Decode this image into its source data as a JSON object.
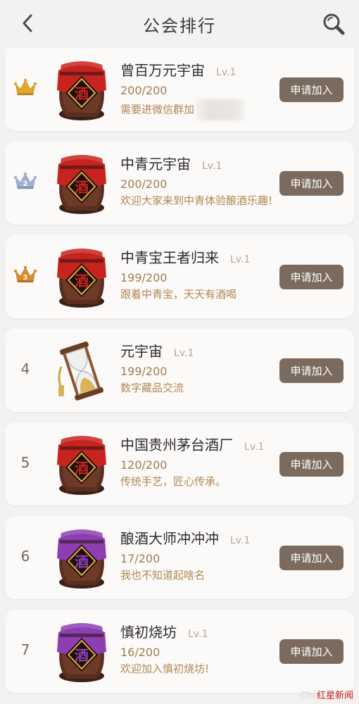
{
  "header": {
    "title": "公会排行"
  },
  "guilds": [
    {
      "rank": "",
      "rank_icon": "gold-crown-icon",
      "rank_color": "#e2a628",
      "emblem": "red-wine-jar-icon",
      "emblem_color": "#c7231f",
      "name": "曾百万元宇宙",
      "level": "Lv.1",
      "count": "200/200",
      "desc": "需要进微信群加",
      "join_label": "申请加入"
    },
    {
      "rank": "2",
      "rank_icon": "silver-crown-icon",
      "rank_color": "#9fb0d6",
      "emblem": "red-wine-jar-icon",
      "emblem_color": "#c7231f",
      "name": "中青元宇宙",
      "level": "Lv.1",
      "count": "200/200",
      "desc": "欢迎大家来到中青体验酿酒乐趣!",
      "join_label": "申请加入"
    },
    {
      "rank": "3",
      "rank_icon": "bronze-crown-icon",
      "rank_color": "#dd8a2b",
      "emblem": "red-wine-jar-icon",
      "emblem_color": "#c7231f",
      "name": "中青宝王者归来",
      "level": "Lv.1",
      "count": "199/200",
      "desc": "跟着中青宝，天天有酒喝",
      "join_label": "申请加入"
    },
    {
      "rank": "4",
      "emblem": "hourglass-icon",
      "name": "元宇宙",
      "level": "Lv.1",
      "count": "199/200",
      "desc": "数字藏品交流",
      "join_label": "申请加入"
    },
    {
      "rank": "5",
      "emblem": "red-wine-jar-icon",
      "emblem_color": "#c7231f",
      "name": "中国贵州茅台酒厂",
      "level": "Lv.1",
      "count": "120/200",
      "desc": "传统手艺，匠心传承。",
      "join_label": "申请加入"
    },
    {
      "rank": "6",
      "emblem": "purple-wine-jar-icon",
      "emblem_color": "#8d3fb1",
      "name": "酿酒大师冲冲冲",
      "level": "Lv.1",
      "count": "17/200",
      "desc": "我也不知道起啥名",
      "join_label": "申请加入"
    },
    {
      "rank": "7",
      "emblem": "purple-wine-jar-icon",
      "emblem_color": "#8d3fb1",
      "name": "慎初烧坊",
      "level": "Lv.1",
      "count": "16/200",
      "desc": "欢迎加入慎初烧坊!",
      "join_label": "申请加入"
    }
  ],
  "jar_label": "酒",
  "watermark": {
    "chi": "Chi",
    "brand": "红星新闻"
  },
  "colors": {
    "button": "#7a6b5e",
    "background": "#f4f2f1",
    "desc": "#b18752"
  }
}
